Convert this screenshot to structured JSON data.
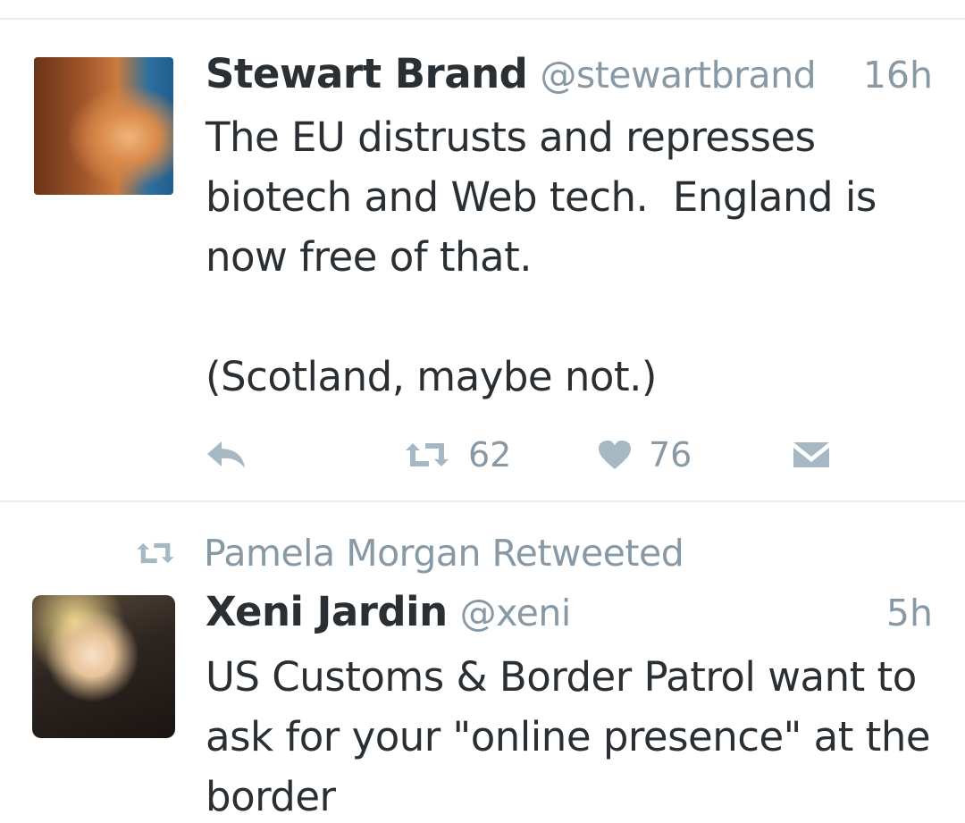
{
  "tweets": [
    {
      "name": "Stewart Brand",
      "handle": "@stewartbrand",
      "time": "16h",
      "text": "The EU distrusts and represses\nbiotech and Web tech.  England is\nnow free of that.\n\n(Scotland, maybe not.)",
      "retweets": "62",
      "likes": "76",
      "avatar_icon": "avatar-photo"
    },
    {
      "retweeted_by": "Pamela Morgan Retweeted",
      "name": "Xeni Jardin",
      "handle": "@xeni",
      "time": "5h",
      "text": "US Customs & Border Patrol want to\nask for your \"online presence\" at the\nborder",
      "avatar_icon": "avatar-photo"
    }
  ],
  "icons": {
    "reply": "reply-icon",
    "retweet": "retweet-icon",
    "like": "heart-icon",
    "message": "direct-message-icon"
  },
  "colors": {
    "text": "#292f33",
    "secondary": "#8899a6",
    "icon": "#a6b8c4",
    "divider": "#e6ecf0"
  }
}
